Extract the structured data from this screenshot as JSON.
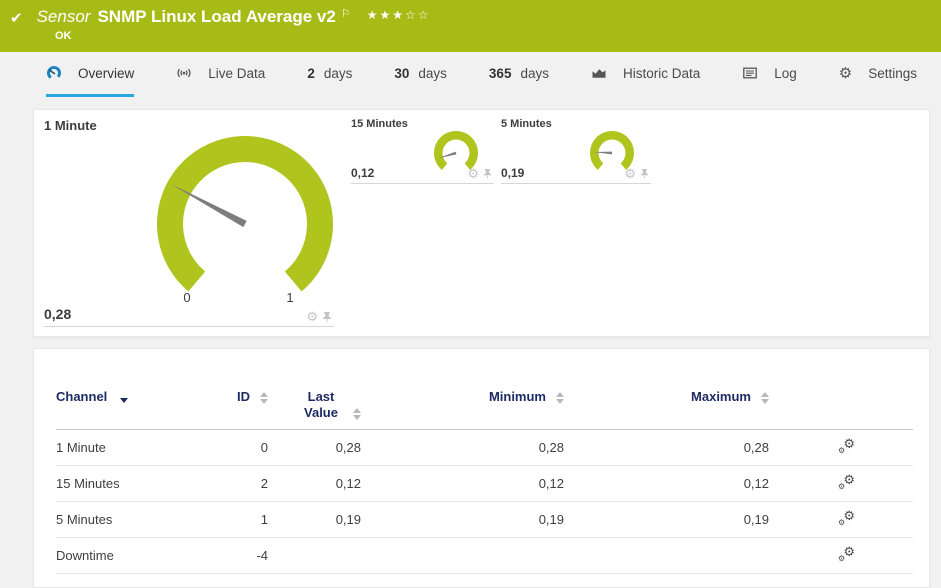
{
  "colors": {
    "header_green": "#a7bb17",
    "gauge_green": "#b0c41e",
    "needle_gray": "#7d7d7d",
    "accent_blue": "#2ba7e0",
    "tab_icon_blue": "#1d85c4",
    "table_header_navy": "#1e2b63"
  },
  "icons": {
    "check_glyph": "✔",
    "flag_glyph": "⚐",
    "gear_glyph": "⚙"
  },
  "header": {
    "kind": "Sensor",
    "title": "SNMP Linux Load Average v2",
    "stars": "★★★☆☆",
    "status": "OK"
  },
  "tabs": [
    {
      "bold": "",
      "label": "Overview"
    },
    {
      "bold": "",
      "label": "Live Data"
    },
    {
      "bold": "2",
      "label": "days"
    },
    {
      "bold": "30",
      "label": "days"
    },
    {
      "bold": "365",
      "label": "days"
    },
    {
      "bold": "",
      "label": "Historic Data"
    },
    {
      "bold": "",
      "label": "Log"
    },
    {
      "bold": "",
      "label": "Settings"
    }
  ],
  "gauges": [
    {
      "label": "1 Minute",
      "value": 0.28,
      "value_text": "0,28",
      "scale_min": 0,
      "scale_max": 1,
      "min_label": "0",
      "max_label": "1"
    },
    {
      "label": "15 Minutes",
      "value": 0.12,
      "value_text": "0,12",
      "scale_min": 0,
      "scale_max": 1
    },
    {
      "label": "5 Minutes",
      "value": 0.19,
      "value_text": "0,19",
      "scale_min": 0,
      "scale_max": 1
    }
  ],
  "table": {
    "columns": {
      "channel": "Channel",
      "id": "ID",
      "last_value": "Last Value",
      "minimum": "Minimum",
      "maximum": "Maximum"
    },
    "rows": [
      {
        "channel": "1 Minute",
        "id": "0",
        "last": "0,28",
        "min": "0,28",
        "max": "0,28"
      },
      {
        "channel": "15 Minutes",
        "id": "2",
        "last": "0,12",
        "min": "0,12",
        "max": "0,12"
      },
      {
        "channel": "5 Minutes",
        "id": "1",
        "last": "0,19",
        "min": "0,19",
        "max": "0,19"
      },
      {
        "channel": "Downtime",
        "id": "-4",
        "last": "",
        "min": "",
        "max": ""
      }
    ]
  }
}
